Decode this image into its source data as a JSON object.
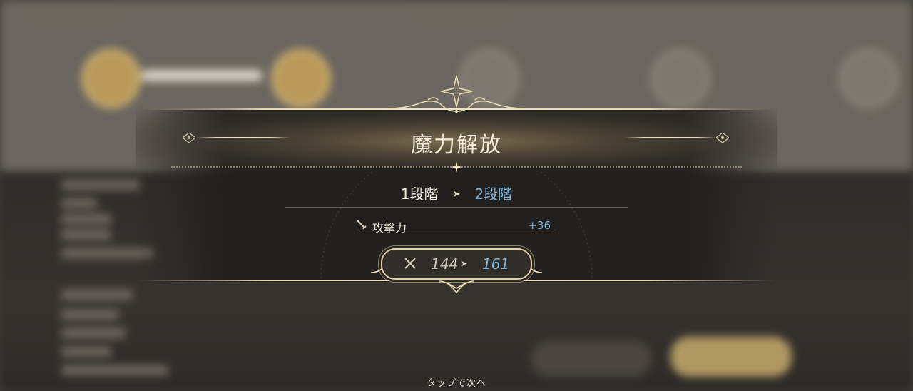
{
  "dialog": {
    "title": "魔力解放",
    "stage_from": "1段階",
    "stage_to": "2段階",
    "stat": {
      "name": "攻撃力",
      "delta": "+36",
      "current": "144",
      "next": "161",
      "icon": "sword-icon"
    },
    "hint": "タップで次へ"
  },
  "colors": {
    "accent_gold": "#e6d7ae",
    "upgrade_blue": "#7fb4d6",
    "text_light": "#f1ebde"
  }
}
